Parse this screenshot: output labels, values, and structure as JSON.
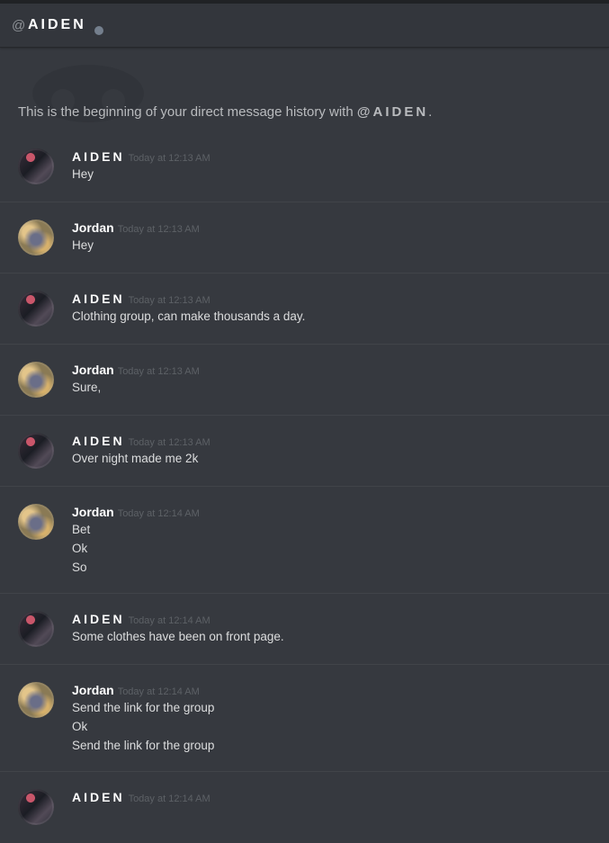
{
  "header": {
    "at_symbol": "@",
    "channel_name": "AIDEN",
    "status": "offline"
  },
  "intro": {
    "text": "This is the beginning of your direct message history with ",
    "mention": "@AIDEN",
    "suffix": "."
  },
  "messages": [
    {
      "author": "AIDEN",
      "timestamp": "Today at 12:13 AM",
      "lines": [
        "Hey"
      ]
    },
    {
      "author": "Jordan",
      "timestamp": "Today at 12:13 AM",
      "lines": [
        "Hey"
      ]
    },
    {
      "author": "AIDEN",
      "timestamp": "Today at 12:13 AM",
      "lines": [
        "Clothing group, can make thousands a day."
      ]
    },
    {
      "author": "Jordan",
      "timestamp": "Today at 12:13 AM",
      "lines": [
        "Sure,"
      ]
    },
    {
      "author": "AIDEN",
      "timestamp": "Today at 12:13 AM",
      "lines": [
        "Over night made me 2k"
      ]
    },
    {
      "author": "Jordan",
      "timestamp": "Today at 12:14 AM",
      "lines": [
        "Bet",
        "Ok",
        "So"
      ]
    },
    {
      "author": "AIDEN",
      "timestamp": "Today at 12:14 AM",
      "lines": [
        "Some clothes have been on front page."
      ]
    },
    {
      "author": "Jordan",
      "timestamp": "Today at 12:14 AM",
      "lines": [
        "Send the link for the group",
        "Ok",
        "Send the link for the group"
      ]
    },
    {
      "author": "AIDEN",
      "timestamp": "Today at 12:14 AM",
      "lines": []
    }
  ],
  "colors": {
    "background": "#36393f",
    "topbar": "#33363c",
    "username": "#ffffff",
    "message_text": "#dcddde",
    "timestamp": "#5d6166",
    "status_offline": "#747f8d"
  }
}
